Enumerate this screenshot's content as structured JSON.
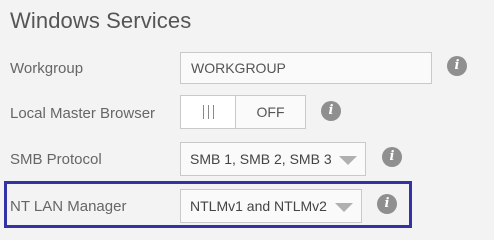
{
  "page": {
    "title": "Windows Services"
  },
  "workgroup": {
    "label": "Workgroup",
    "value": "WORKGROUP",
    "info_icon": "info-icon"
  },
  "local_master_browser": {
    "label": "Local Master Browser",
    "state": "OFF",
    "handle_icon": "grip-icon",
    "info_icon": "info-icon"
  },
  "smb_protocol": {
    "label": "SMB Protocol",
    "selected": "SMB 1, SMB 2, SMB 3",
    "dropdown_icon": "chevron-down-icon",
    "info_icon": "info-icon"
  },
  "nt_lan_manager": {
    "label": "NT LAN Manager",
    "selected": "NTLMv1 and NTLMv2",
    "dropdown_icon": "chevron-down-icon",
    "info_icon": "info-icon",
    "highlighted": true
  },
  "info_glyph": "i",
  "colors": {
    "background": "#f3f3f3",
    "text": "#555555",
    "control_border": "#c9c9c9",
    "info_icon": "#8f8f8f",
    "highlight_border": "#3333a6"
  }
}
